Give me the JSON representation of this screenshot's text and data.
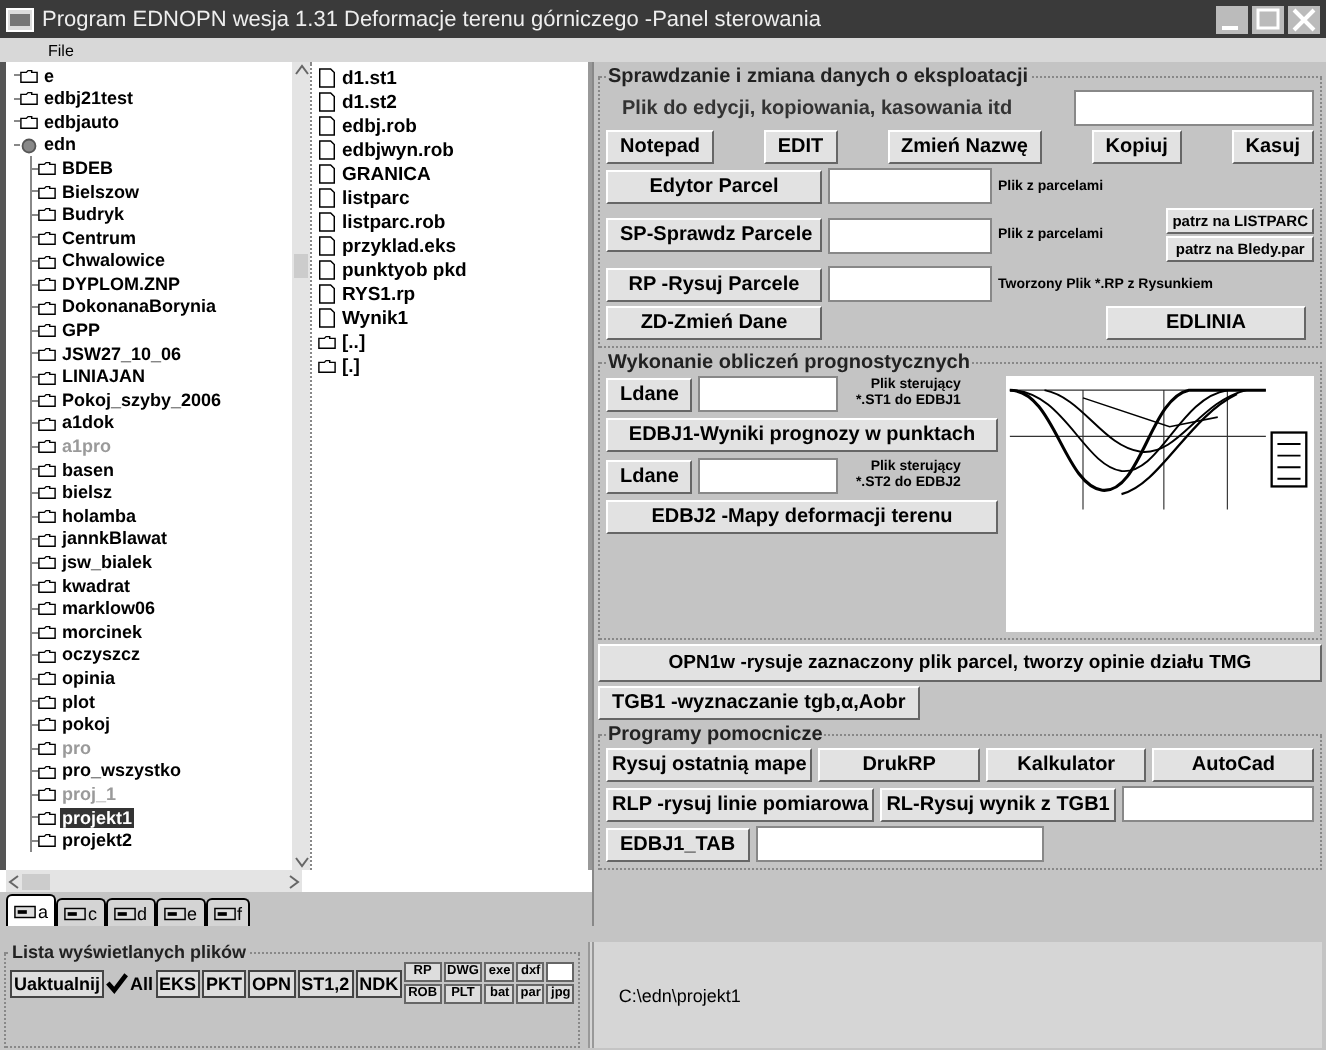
{
  "window": {
    "title": "Program EDNOPN  wesja 1.31   Deformacje terenu górniczego -Panel sterowania"
  },
  "menu": [
    "File"
  ],
  "tree": [
    {
      "label": "e",
      "dimmed": false,
      "selected": false
    },
    {
      "label": "edbj21test",
      "dimmed": false,
      "selected": false
    },
    {
      "label": "edbjauto",
      "dimmed": false,
      "selected": false
    },
    {
      "label": "edn",
      "dimmed": false,
      "selected": false,
      "expanded": true,
      "children": [
        {
          "label": "BDEB",
          "dimmed": false,
          "selected": false
        },
        {
          "label": "Bielszow",
          "dimmed": false,
          "selected": false
        },
        {
          "label": "Budryk",
          "dimmed": false,
          "selected": false
        },
        {
          "label": "Centrum",
          "dimmed": false,
          "selected": false
        },
        {
          "label": "Chwalowice",
          "dimmed": false,
          "selected": false
        },
        {
          "label": "DYPLOM.ZNP",
          "dimmed": false,
          "selected": false
        },
        {
          "label": "DokonanaBorynia",
          "dimmed": false,
          "selected": false
        },
        {
          "label": "GPP",
          "dimmed": false,
          "selected": false
        },
        {
          "label": "JSW27_10_06",
          "dimmed": false,
          "selected": false
        },
        {
          "label": "LINIAJAN",
          "dimmed": false,
          "selected": false
        },
        {
          "label": "Pokoj_szyby_2006",
          "dimmed": false,
          "selected": false
        },
        {
          "label": "a1dok",
          "dimmed": false,
          "selected": false
        },
        {
          "label": "a1pro",
          "dimmed": true,
          "selected": false
        },
        {
          "label": "basen",
          "dimmed": false,
          "selected": false
        },
        {
          "label": "bielsz",
          "dimmed": false,
          "selected": false
        },
        {
          "label": "holamba",
          "dimmed": false,
          "selected": false
        },
        {
          "label": "jannkBlawat",
          "dimmed": false,
          "selected": false
        },
        {
          "label": "jsw_bialek",
          "dimmed": false,
          "selected": false
        },
        {
          "label": "kwadrat",
          "dimmed": false,
          "selected": false
        },
        {
          "label": "marklow06",
          "dimmed": false,
          "selected": false
        },
        {
          "label": "morcinek",
          "dimmed": false,
          "selected": false
        },
        {
          "label": "oczyszcz",
          "dimmed": false,
          "selected": false
        },
        {
          "label": "opinia",
          "dimmed": false,
          "selected": false
        },
        {
          "label": "plot",
          "dimmed": false,
          "selected": false
        },
        {
          "label": "pokoj",
          "dimmed": false,
          "selected": false
        },
        {
          "label": "pro",
          "dimmed": true,
          "selected": false
        },
        {
          "label": "pro_wszystko",
          "dimmed": false,
          "selected": false
        },
        {
          "label": "proj_1",
          "dimmed": true,
          "selected": false
        },
        {
          "label": "projekt1",
          "dimmed": false,
          "selected": true
        },
        {
          "label": "projekt2",
          "dimmed": false,
          "selected": false
        }
      ]
    }
  ],
  "files": [
    {
      "kind": "file",
      "name": "d1.st1"
    },
    {
      "kind": "file",
      "name": "d1.st2"
    },
    {
      "kind": "file",
      "name": "edbj.rob"
    },
    {
      "kind": "file",
      "name": "edbjwyn.rob"
    },
    {
      "kind": "file",
      "name": "GRANICA"
    },
    {
      "kind": "file",
      "name": "listparc"
    },
    {
      "kind": "file",
      "name": "listparc.rob"
    },
    {
      "kind": "file",
      "name": "przyklad.eks"
    },
    {
      "kind": "file",
      "name": "punktyob pkd"
    },
    {
      "kind": "file",
      "name": "RYS1.rp"
    },
    {
      "kind": "file",
      "name": "Wynik1"
    },
    {
      "kind": "folder",
      "name": "[..]"
    },
    {
      "kind": "folder",
      "name": "[.]"
    }
  ],
  "drives": [
    {
      "label": "a",
      "selected": true
    },
    {
      "label": "c",
      "selected": false
    },
    {
      "label": "d",
      "selected": false
    },
    {
      "label": "e",
      "selected": false
    },
    {
      "label": "f",
      "selected": false
    }
  ],
  "data_group": {
    "title": "Sprawdzanie i zmiana danych o eksploatacji",
    "file_label": "Plik do edycji, kopiowania,  kasowania itd",
    "buttons": [
      "Notepad",
      "EDIT",
      "Zmień Nazwę",
      "Kopiuj",
      "Kasuj"
    ],
    "parcel_editor": {
      "button": "Edytor Parcel",
      "note": "Plik z parcelami"
    },
    "parcel_check": {
      "button": "SP-Sprawdz Parcele",
      "note": "Plik z parcelami",
      "links": [
        "patrz na LISTPARC",
        "patrz na Bledy.par"
      ]
    },
    "parcel_draw": {
      "button": "RP -Rysuj Parcele",
      "note": "Tworzony Plik *.RP z Rysunkiem"
    },
    "change_data": "ZD-Zmień Dane",
    "edlinia": "EDLINIA"
  },
  "forecast_group": {
    "title": "Wykonanie obliczeń prognostycznych",
    "rows": [
      {
        "kind": "input",
        "button": "Ldane",
        "note": "Plik sterujący *.ST1 do EDBJ1"
      },
      {
        "kind": "button",
        "button": "EDBJ1-Wyniki prognozy w punktach"
      },
      {
        "kind": "input",
        "button": "Ldane",
        "note": "Plik sterujący *.ST2 do EDBJ2"
      },
      {
        "kind": "button",
        "button": "EDBJ2 -Mapy deformacji terenu"
      }
    ]
  },
  "opn_button": "OPN1w -rysuje zaznaczony plik parcel, tworzy opinie działu TMG",
  "tgb_button": "TGB1 -wyznaczanie tgb,α,Aobr",
  "helper_group": {
    "title": "Programy pomocnicze",
    "row1": [
      "Rysuj ostatnią mape",
      "DrukRP",
      "Kalkulator",
      "AutoCad"
    ],
    "row2": [
      "RLP -rysuj linie pomiarowa",
      "RL-Rysuj wynik z TGB1"
    ],
    "row3": "EDBJ1_TAB"
  },
  "file_filter": {
    "title": "Lista wyświetlanych plików",
    "refresh": "Uaktualnij",
    "all": "All",
    "types": [
      "EKS",
      "PKT",
      "OPN",
      "ST1,2",
      "NDK"
    ],
    "pairs": [
      [
        "RP",
        "ROB"
      ],
      [
        "DWG",
        "PLT"
      ],
      [
        "exe",
        "bat"
      ],
      [
        "dxf",
        "par"
      ]
    ],
    "extra": "jpg"
  },
  "path": "C:\\edn\\projekt1"
}
